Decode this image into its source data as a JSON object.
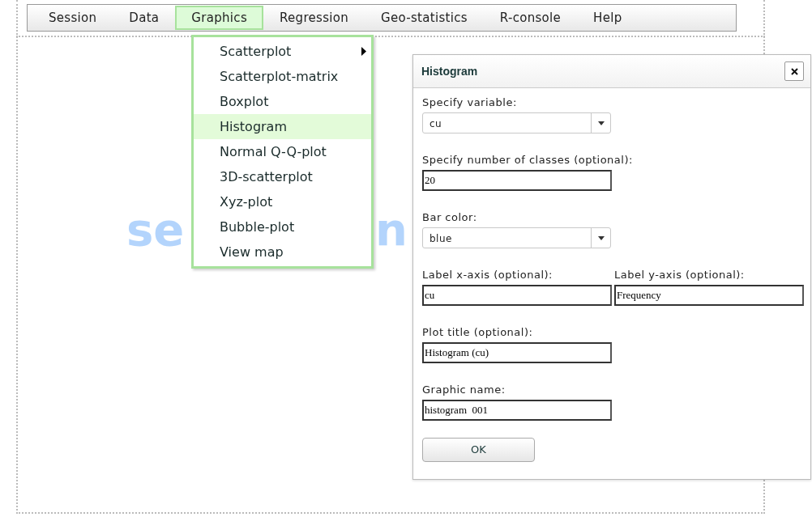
{
  "menubar": [
    {
      "label": "Session",
      "selected": false
    },
    {
      "label": "Data",
      "selected": false
    },
    {
      "label": "Graphics",
      "selected": true
    },
    {
      "label": "Regression",
      "selected": false
    },
    {
      "label": "Geo-statistics",
      "selected": false
    },
    {
      "label": "R-console",
      "selected": false
    },
    {
      "label": "Help",
      "selected": false
    }
  ],
  "logo": [
    "se",
    "n"
  ],
  "dropdown": [
    {
      "label": "Scatterplot",
      "selected": false,
      "submenu": true
    },
    {
      "label": "Scatterplot-matrix",
      "selected": false,
      "submenu": false
    },
    {
      "label": "Boxplot",
      "selected": false,
      "submenu": false
    },
    {
      "label": "Histogram",
      "selected": true,
      "submenu": false
    },
    {
      "label": "Normal Q-Q-plot",
      "selected": false,
      "submenu": false
    },
    {
      "label": "3D-scatterplot",
      "selected": false,
      "submenu": false
    },
    {
      "label": "Xyz-plot",
      "selected": false,
      "submenu": false
    },
    {
      "label": "Bubble-plot",
      "selected": false,
      "submenu": false
    },
    {
      "label": "View map",
      "selected": false,
      "submenu": false
    }
  ],
  "dialog": {
    "title": "Histogram",
    "rows": [
      [
        {
          "kind": "select",
          "label": "Specify variable:",
          "value": "cu"
        }
      ],
      [
        {
          "kind": "text",
          "label": "Specify number of classes (optional):",
          "value": "20"
        }
      ],
      [
        {
          "kind": "select",
          "label": "Bar color:",
          "value": "blue"
        }
      ],
      [
        {
          "kind": "text",
          "label": "Label x-axis (optional):",
          "value": "cu"
        },
        {
          "kind": "text",
          "label": "Label y-axis (optional):",
          "value": "Frequency"
        }
      ],
      [
        {
          "kind": "text",
          "label": "Plot title (optional):",
          "value": "Histogram (cu)"
        }
      ],
      [
        {
          "kind": "text",
          "label": "Graphic name:",
          "value": "histogram  001"
        }
      ]
    ],
    "button": "OK"
  }
}
